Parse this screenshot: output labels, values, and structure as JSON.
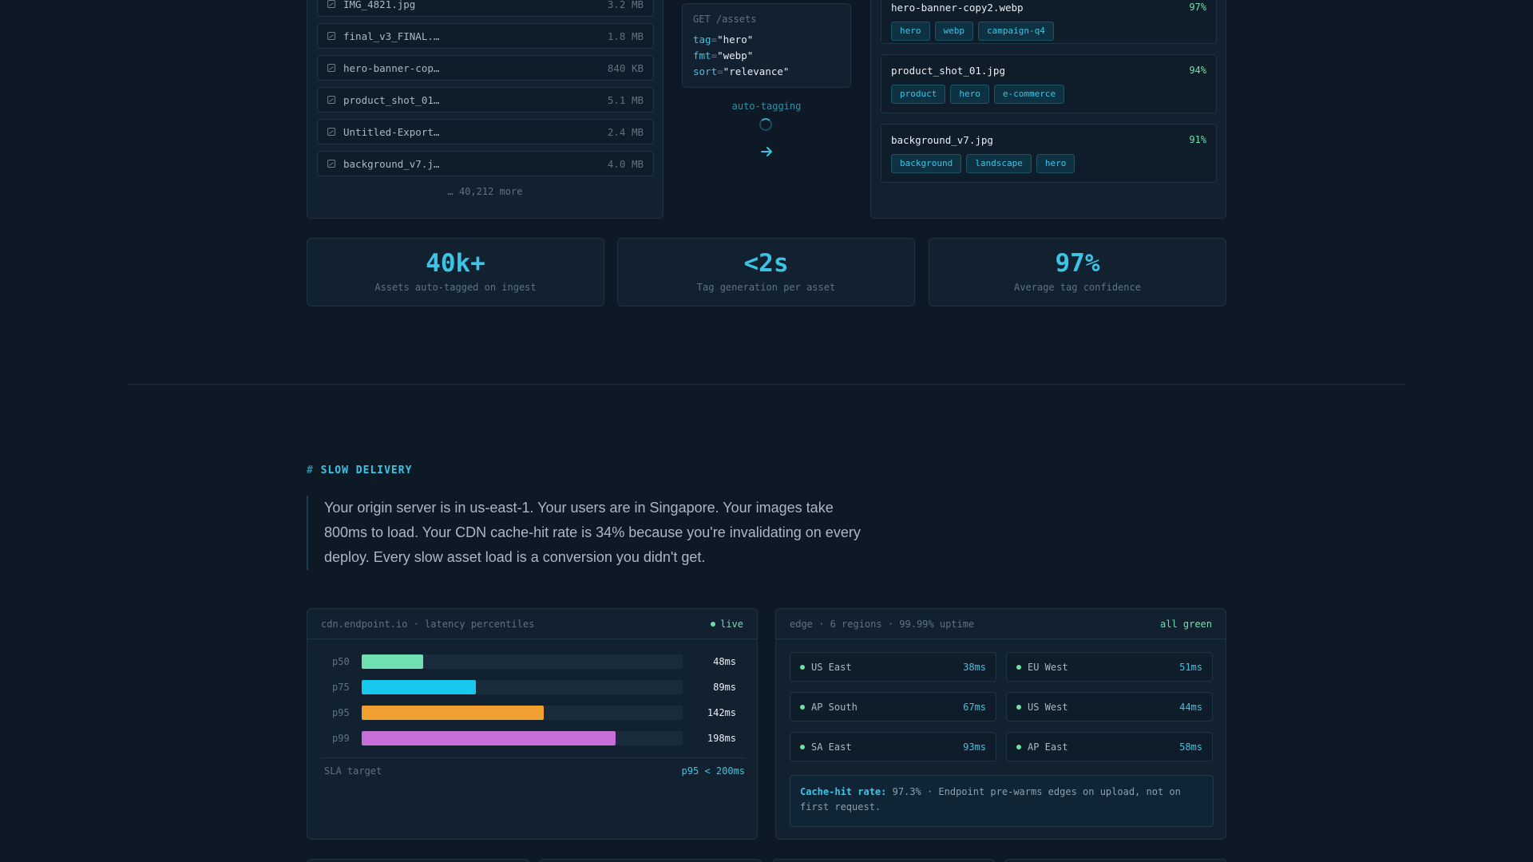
{
  "file_list": {
    "files": [
      {
        "name": "IMG_4821.jpg",
        "size": "3.2 MB"
      },
      {
        "name": "final_v3_FINAL.…",
        "size": "1.8 MB"
      },
      {
        "name": "hero-banner-cop…",
        "size": "840 KB"
      },
      {
        "name": "product_shot_01…",
        "size": "5.1 MB"
      },
      {
        "name": "Untitled-Export…",
        "size": "2.4 MB"
      },
      {
        "name": "background_v7.j…",
        "size": "4.0 MB"
      }
    ],
    "more": "… 40,212 more"
  },
  "request": {
    "method": "GET /assets",
    "params": [
      {
        "key": "tag",
        "value": "\"hero\""
      },
      {
        "key": "fmt",
        "value": "\"webp\""
      },
      {
        "key": "sort",
        "value": "\"relevance\""
      }
    ],
    "status": "auto-tagging",
    "icons": {
      "spinner": "loading-spinner-icon",
      "arrow": "arrow-right-icon"
    }
  },
  "results": [
    {
      "name": "hero-banner-copy2.webp",
      "confidence": "97%",
      "tags": [
        "hero",
        "webp",
        "campaign-q4"
      ]
    },
    {
      "name": "product_shot_01.jpg",
      "confidence": "94%",
      "tags": [
        "product",
        "hero",
        "e-commerce"
      ]
    },
    {
      "name": "background_v7.jpg",
      "confidence": "91%",
      "tags": [
        "background",
        "landscape",
        "hero"
      ]
    }
  ],
  "stats": [
    {
      "value": "40k+",
      "label": "Assets auto-tagged on ingest"
    },
    {
      "value": "<2s",
      "label": "Tag generation per asset"
    },
    {
      "value": "97%",
      "label": "Average tag confidence"
    }
  ],
  "section": {
    "hash": "#",
    "title": "SLOW DELIVERY",
    "body": "Your origin server is in us-east-1. Your users are in Singapore. Your images take 800ms to load. Your CDN cache-hit rate is 34% because you're invalidating on every deploy. Every slow asset load is a conversion you didn't get."
  },
  "latency": {
    "header": "cdn.endpoint.io · latency percentiles",
    "live": "live",
    "scale_max_ms": 250,
    "rows": [
      {
        "label": "p50",
        "value": 48,
        "text": "48ms",
        "color": "#6fe0b0"
      },
      {
        "label": "p75",
        "value": 89,
        "text": "89ms",
        "color": "#16c8ee"
      },
      {
        "label": "p95",
        "value": 142,
        "text": "142ms",
        "color": "#f0a030"
      },
      {
        "label": "p99",
        "value": 198,
        "text": "198ms",
        "color": "#c86ed8"
      }
    ],
    "sla_label": "SLA target",
    "sla_value": "p95 < 200ms"
  },
  "edge": {
    "header": "edge · 6 regions · 99.99% uptime",
    "status": "all green",
    "regions": [
      {
        "name": "US East",
        "ms": "38ms"
      },
      {
        "name": "EU West",
        "ms": "51ms"
      },
      {
        "name": "AP South",
        "ms": "67ms"
      },
      {
        "name": "US West",
        "ms": "44ms"
      },
      {
        "name": "SA East",
        "ms": "93ms"
      },
      {
        "name": "AP East",
        "ms": "58ms"
      }
    ],
    "cache_label": "Cache-hit rate:",
    "cache_text": "97.3% · Endpoint pre-warms edges on upload, not on first request."
  },
  "colors": {
    "accent": "#3bc4e6",
    "success": "#6fe0a8",
    "background": "#0d1a26",
    "panel": "#122130"
  }
}
